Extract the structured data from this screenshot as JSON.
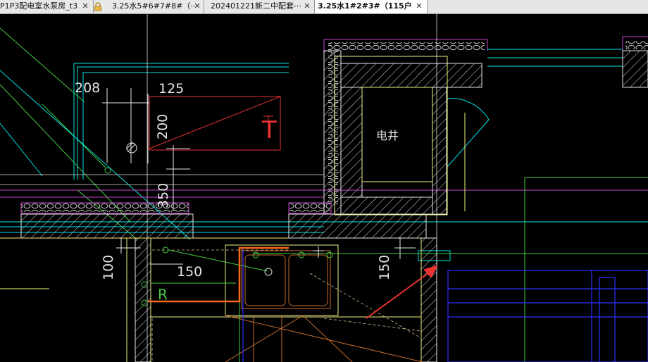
{
  "tabs": [
    {
      "label": "P1P3配电室水泵房_t3",
      "locked": false,
      "active": false,
      "close": "✕"
    },
    {
      "label": "3.25水5#6#7#8#（⋯",
      "locked": true,
      "active": false,
      "close": "✕"
    },
    {
      "label": "202401221新二中配套⋯",
      "locked": false,
      "active": false,
      "close": "✕"
    },
    {
      "label": "3.25水1#2#3#（115户⋯",
      "locked": false,
      "active": true,
      "close": "✕"
    }
  ],
  "drawing": {
    "dim_208": "208",
    "dim_125": "125",
    "dim_200": "200",
    "dim_350": "350",
    "dim_100": "100",
    "dim_150_left": "150",
    "dim_150_right": "150",
    "room_label": "电井",
    "tag_T": "T",
    "tag_R": "R"
  },
  "colors": {
    "background": "#000000",
    "wall": "#e6e6e6",
    "magenta": "#cc44cc",
    "cyan": "#00e5e5",
    "yellow": "#f0f080",
    "green": "#44cc44",
    "red": "#ee3333",
    "orange": "#ff6a1a",
    "blue": "#3030ff",
    "tab_active_bg": "#ffffff",
    "tab_bg": "#e8e8e8"
  }
}
